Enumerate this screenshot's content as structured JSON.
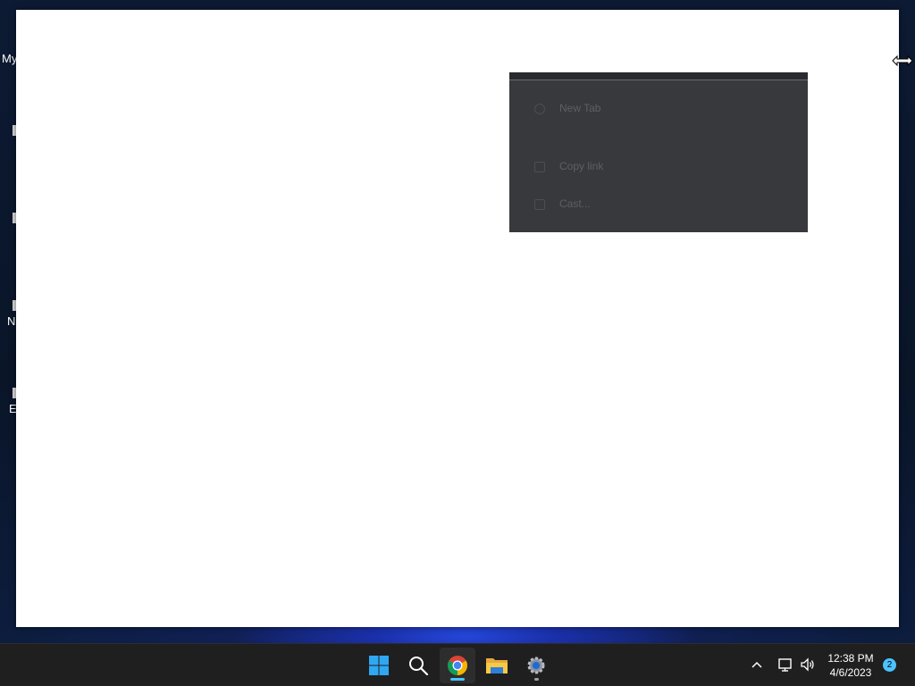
{
  "desktop": {
    "icon_labels": [
      "My",
      "N",
      "E"
    ]
  },
  "context_menu": {
    "items": [
      {
        "label": "New Tab",
        "sublabel": "",
        "icon": "globe-icon"
      },
      {
        "label": "Copy link",
        "icon": "link-icon"
      },
      {
        "label": "Cast...",
        "icon": "cast-icon"
      }
    ]
  },
  "taskbar": {
    "apps": [
      {
        "name": "Start",
        "icon": "windows-start-icon"
      },
      {
        "name": "Search",
        "icon": "search-icon"
      },
      {
        "name": "Google Chrome",
        "icon": "chrome-icon",
        "active": true
      },
      {
        "name": "File Explorer",
        "icon": "folder-icon"
      },
      {
        "name": "Settings",
        "icon": "gear-icon"
      }
    ],
    "tray": {
      "clock_time": "12:38 PM",
      "clock_date": "4/6/2023",
      "notification_count": "2"
    }
  },
  "colors": {
    "taskbar_bg": "#1f1f1f",
    "accent": "#4cc2ff",
    "menu_bg": "#37393c"
  }
}
